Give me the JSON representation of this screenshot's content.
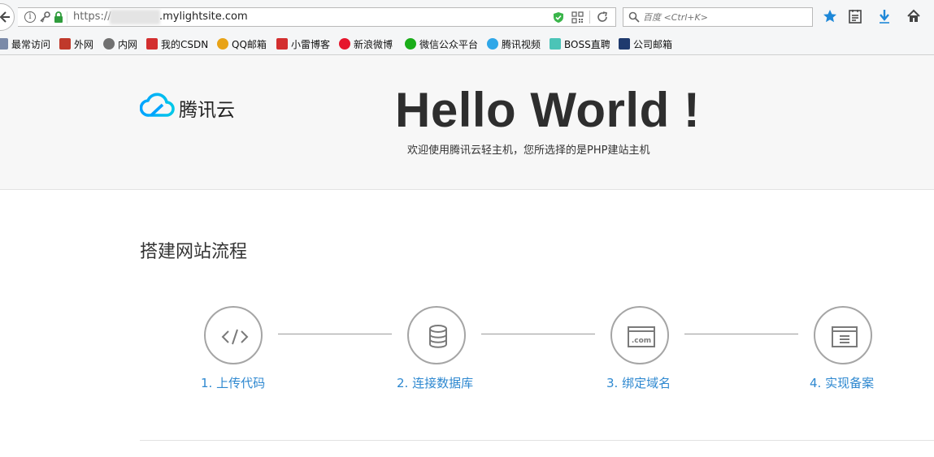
{
  "browser": {
    "url_prefix": "https://",
    "url_host": ".mylightsite.com",
    "search_placeholder": "百度 <Ctrl+K>"
  },
  "bookmarks": [
    {
      "label": "最常访问",
      "color": "#7a8aa8"
    },
    {
      "label": "外网",
      "color": "#c0392b"
    },
    {
      "label": "内网",
      "color": "#707070"
    },
    {
      "label": "我的CSDN",
      "color": "#d32f2f"
    },
    {
      "label": "QQ邮箱",
      "color": "#e8a317"
    },
    {
      "label": "小雷博客",
      "color": "#d32f2f"
    },
    {
      "label": "新浪微博",
      "color": "#e6162d"
    },
    {
      "label": "微信公众平台",
      "color": "#1aad19"
    },
    {
      "label": "腾讯视频",
      "color": "#2fa7e8"
    },
    {
      "label": "BOSS直聘",
      "color": "#4bc4b7"
    },
    {
      "label": "公司邮箱",
      "color": "#1f3a6e"
    }
  ],
  "page": {
    "logo_text": "腾讯云",
    "hero_title": "Hello World !",
    "hero_subtitle": "欢迎使用腾讯云轻主机，您所选择的是PHP建站主机",
    "section_title": "搭建网站流程",
    "steps": [
      {
        "label": "1. 上传代码",
        "icon": "code-icon"
      },
      {
        "label": "2. 连接数据库",
        "icon": "database-icon"
      },
      {
        "label": "3. 绑定域名",
        "icon": "domain-icon"
      },
      {
        "label": "4. 实现备案",
        "icon": "record-icon"
      }
    ]
  },
  "colors": {
    "link": "#2e88d0",
    "star": "#1e88d8",
    "download": "#1e88d8"
  }
}
